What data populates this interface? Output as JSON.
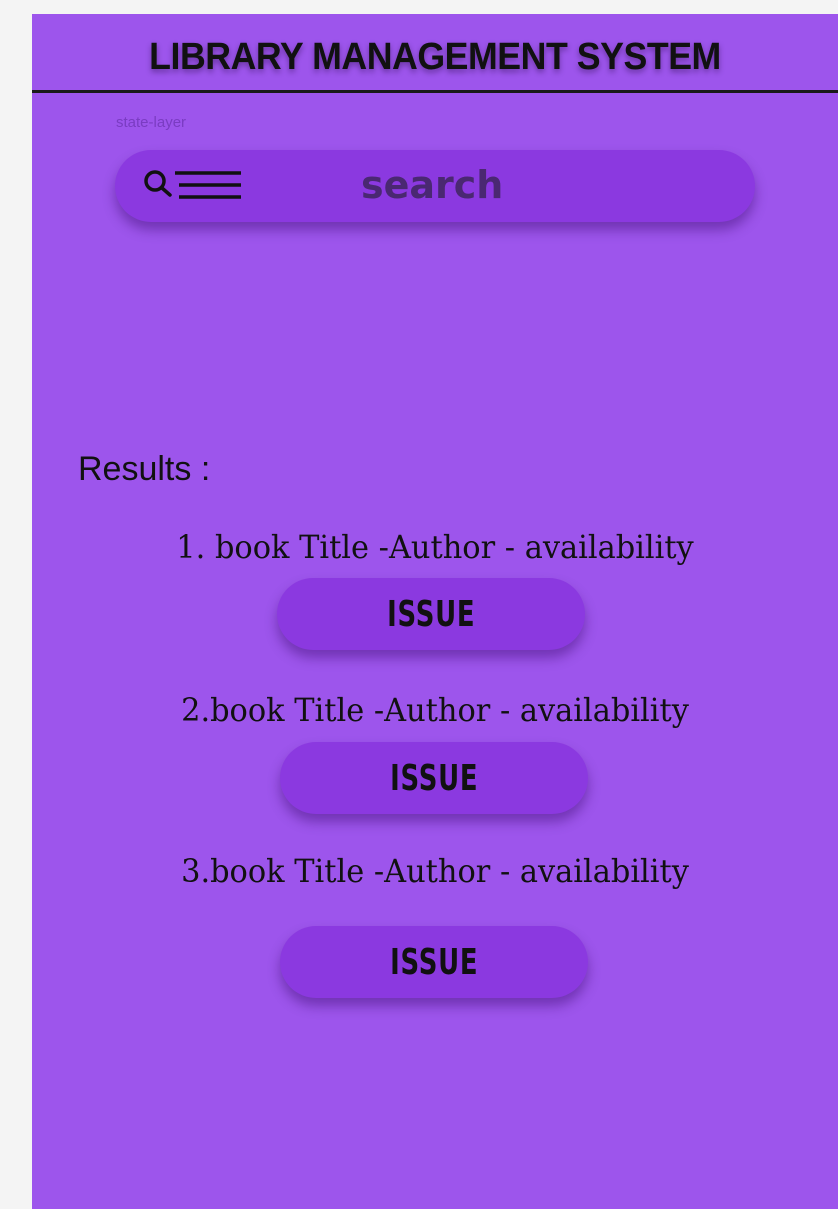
{
  "app": {
    "title": "LIBRARY MANAGEMENT SYSTEM",
    "state_layer_label": "state-layer"
  },
  "search": {
    "placeholder": "search",
    "icon": "search-menu-icon"
  },
  "results": {
    "label": "Results :",
    "items": [
      {
        "text": "1. book Title -Author - availability",
        "button_label": "ISSUE"
      },
      {
        "text": "2.book Title -Author - availability",
        "button_label": "ISSUE"
      },
      {
        "text": "3.book Title -Author - availability",
        "button_label": "ISSUE"
      }
    ]
  },
  "colors": {
    "background": "#9d55ec",
    "button": "#8b39e0",
    "canvas": "#f4f4f4"
  }
}
